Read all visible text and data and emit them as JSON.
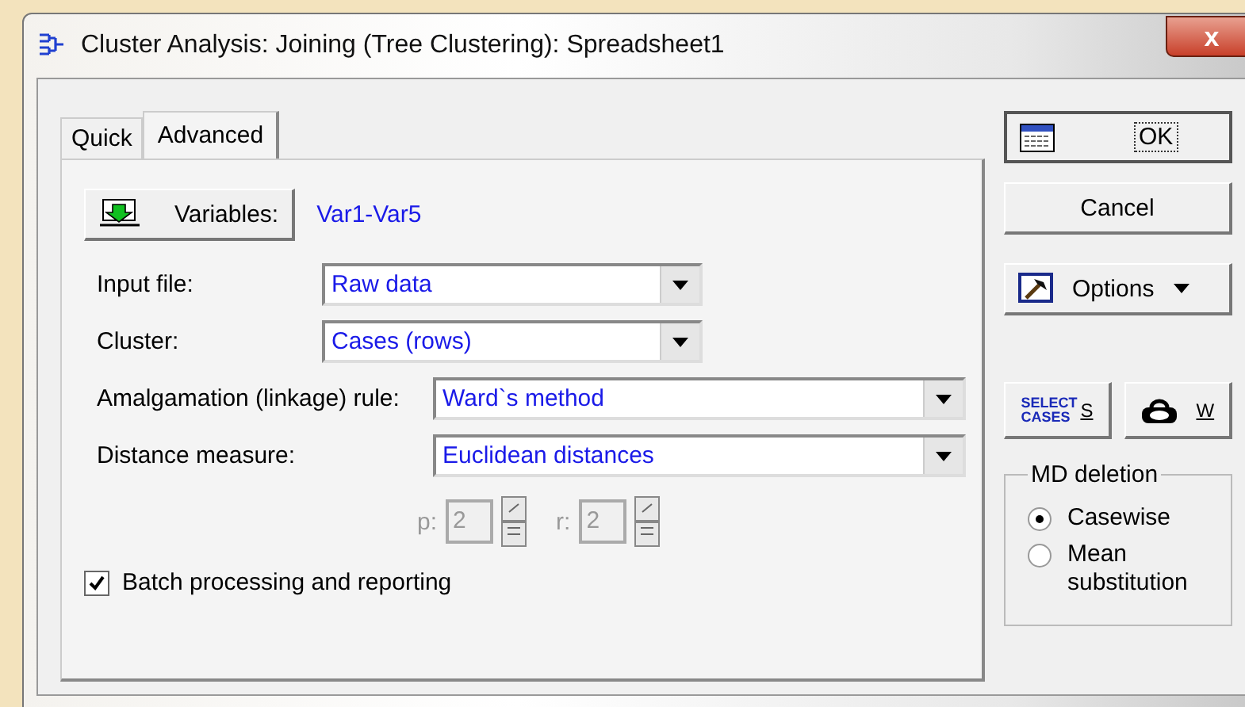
{
  "window": {
    "title": "Cluster Analysis: Joining (Tree Clustering): Spreadsheet1",
    "close": "x"
  },
  "tabs": [
    {
      "label": "Quick",
      "selected": false
    },
    {
      "label": "Advanced",
      "selected": true
    }
  ],
  "variables": {
    "button": "Variables:",
    "value": "Var1-Var5"
  },
  "dropdowns": [
    {
      "kind": "narrow",
      "label": "Input file:",
      "value": "Raw data"
    },
    {
      "kind": "narrow",
      "label": "Cluster:",
      "value": "Cases (rows)"
    },
    {
      "kind": "wide",
      "label": "Amalgamation (linkage) rule:",
      "value": "Ward`s method"
    },
    {
      "kind": "wide",
      "label": "Distance measure:",
      "value": "Euclidean distances"
    }
  ],
  "spinners": [
    {
      "label": "p:",
      "value": "2",
      "disabled": true
    },
    {
      "label": "r:",
      "value": "2",
      "disabled": true
    }
  ],
  "batch": {
    "label": "Batch processing and reporting",
    "checked": true
  },
  "buttons": {
    "ok": "OK",
    "cancel": "Cancel",
    "options": "Options"
  },
  "select_cases": {
    "label": "SELECT CASES",
    "key": "S"
  },
  "weight": {
    "key": "W"
  },
  "md_deletion": {
    "title": "MD deletion",
    "options": [
      {
        "label": "Casewise",
        "selected": true
      },
      {
        "label": "Mean substitution",
        "selected": false
      }
    ]
  }
}
